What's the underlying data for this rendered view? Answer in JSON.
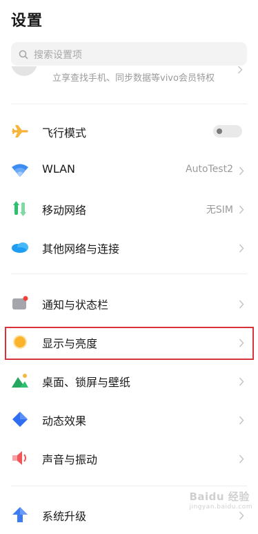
{
  "header": {
    "title": "设置"
  },
  "search": {
    "placeholder": "搜索设置项"
  },
  "account": {
    "subtitle": "立享查找手机、同步数据等vivo会员特权"
  },
  "settings": {
    "airplane": {
      "label": "飞行模式",
      "enabled": false
    },
    "wlan": {
      "label": "WLAN",
      "value": "AutoTest2"
    },
    "mobile": {
      "label": "移动网络",
      "value": "无SIM"
    },
    "other_network": {
      "label": "其他网络与连接"
    },
    "notification": {
      "label": "通知与状态栏"
    },
    "display": {
      "label": "显示与亮度"
    },
    "desktop": {
      "label": "桌面、锁屏与壁纸"
    },
    "effects": {
      "label": "动态效果"
    },
    "sound": {
      "label": "声音与振动"
    },
    "upgrade": {
      "label": "系统升级"
    }
  },
  "icons": {
    "airplane": "airplane-icon",
    "wlan": "wifi-icon",
    "mobile": "mobile-data-icon",
    "other_network": "cloud-icon",
    "notification": "notification-icon",
    "display": "brightness-icon",
    "desktop": "wallpaper-icon",
    "effects": "effects-icon",
    "sound": "speaker-icon",
    "upgrade": "upgrade-arrow-icon"
  },
  "highlight_color": "#d8323a",
  "watermark": {
    "text": "Baidu 经验",
    "sub": "jingyan.baidu.com"
  }
}
